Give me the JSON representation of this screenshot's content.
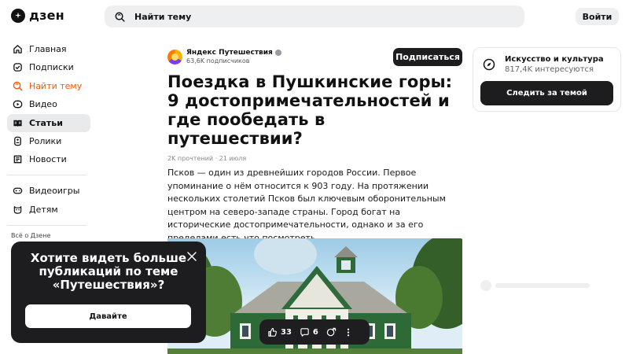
{
  "header": {
    "logo_text": "дзен",
    "search_placeholder": "Найти тему",
    "login_label": "Войти"
  },
  "sidebar": {
    "items": [
      {
        "label": "Главная",
        "icon": "home-icon"
      },
      {
        "label": "Подписки",
        "icon": "subscriptions-icon"
      },
      {
        "label": "Найти тему",
        "icon": "search-topic-icon",
        "accent": true
      },
      {
        "label": "Видео",
        "icon": "video-icon"
      },
      {
        "label": "Статьи",
        "icon": "articles-icon",
        "active": true
      },
      {
        "label": "Ролики",
        "icon": "shorts-icon"
      },
      {
        "label": "Новости",
        "icon": "news-icon"
      }
    ],
    "extra_items": [
      {
        "label": "Видеоигры",
        "icon": "gamepad-icon"
      },
      {
        "label": "Детям",
        "icon": "kids-icon"
      }
    ],
    "footer_label": "Всё о Дзене"
  },
  "article": {
    "author_name": "Яндекс Путешествия",
    "author_subs": "63,6K подписчиков",
    "subscribe_label": "Подписаться",
    "title": "Поездка в Пушкинские горы: 9 достопримечательностей и где пообедать в путешествии?",
    "meta": "2K прочтений · 21 июля",
    "lead": "Псков — один из древнейших городов России. Первое упоминание о нём относится к 903 году. На протяжении нескольких столетий Псков был ключевым оборонительным центром на северо-западе страны. Город богат на исторические достопримечательности, однако и за его пределами есть что посмотреть."
  },
  "reactions": {
    "likes": "33",
    "comments": "6"
  },
  "topic_card": {
    "title": "Искусство и культура",
    "count": "817,4K интересуются",
    "button_label": "Следить за темой"
  },
  "popup": {
    "text": "Хотите видеть больше публикаций по теме «Путешествия»?",
    "button_label": "Давайте"
  },
  "colors": {
    "accent": "#ff5500",
    "dark": "#1d1d1f",
    "search_bg": "#eeeff1"
  }
}
